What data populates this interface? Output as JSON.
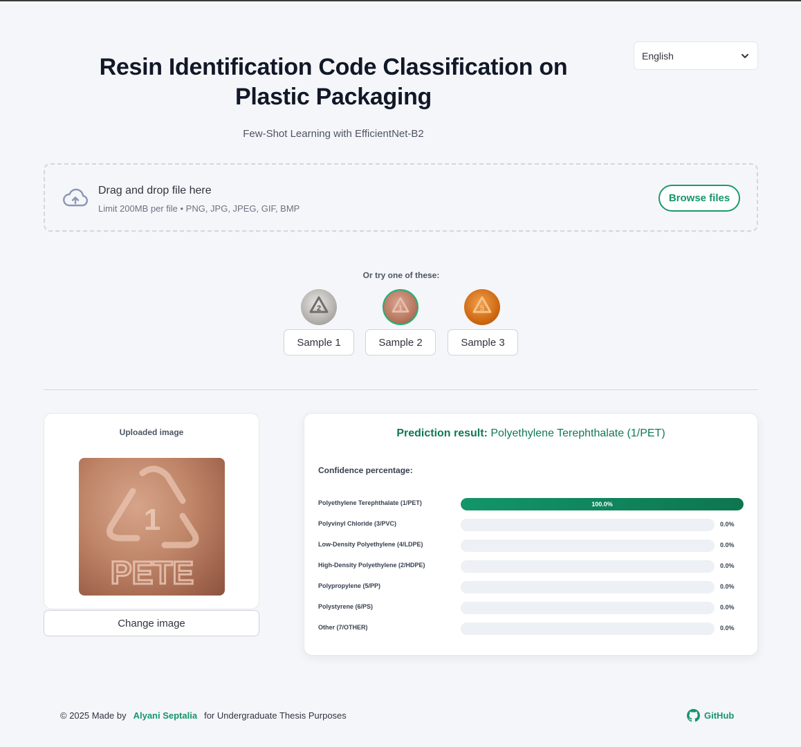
{
  "header": {
    "title": "Resin Identification Code Classification on Plastic Packaging",
    "subtitle": "Few-Shot Learning with EfficientNet-B2"
  },
  "language": {
    "selected": "English",
    "icon": "chevron-down-icon"
  },
  "uploader": {
    "main_text": "Drag and drop file here",
    "limit_text": "Limit 200MB per file • PNG, JPG, JPEG, GIF, BMP",
    "browse_label": "Browse files",
    "icon": "cloud-upload-icon"
  },
  "samples": {
    "prompt": "Or try one of these:",
    "items": [
      {
        "label": "Sample 1",
        "selected": false
      },
      {
        "label": "Sample 2",
        "selected": true
      },
      {
        "label": "Sample 3",
        "selected": false
      }
    ]
  },
  "uploaded": {
    "caption": "Uploaded image",
    "change_label": "Change image"
  },
  "result": {
    "prefix": "Prediction result:",
    "prediction": "Polyethylene Terephthalate (1/PET)",
    "confidence_label": "Confidence percentage:",
    "rows": [
      {
        "label": "Polyethylene Terephthalate (1/PET)",
        "value": "100.0%",
        "fraction": 1.0
      },
      {
        "label": "Polyvinyl Chloride (3/PVC)",
        "value": "0.0%",
        "fraction": 0.0
      },
      {
        "label": "Low-Density Polyethylene (4/LDPE)",
        "value": "0.0%",
        "fraction": 0.0
      },
      {
        "label": "High-Density Polyethylene (2/HDPE)",
        "value": "0.0%",
        "fraction": 0.0
      },
      {
        "label": "Polypropylene (5/PP)",
        "value": "0.0%",
        "fraction": 0.0
      },
      {
        "label": "Polystyrene (6/PS)",
        "value": "0.0%",
        "fraction": 0.0
      },
      {
        "label": "Other (7/OTHER)",
        "value": "0.0%",
        "fraction": 0.0
      }
    ]
  },
  "footer": {
    "copyright": "© 2025 Made by",
    "author": "Alyani Septalia",
    "purpose": "for Undergraduate Thesis Purposes",
    "github_label": "GitHub",
    "github_icon": "github-icon"
  },
  "colors": {
    "accent": "#16966a",
    "bar": "#0f7a52"
  }
}
